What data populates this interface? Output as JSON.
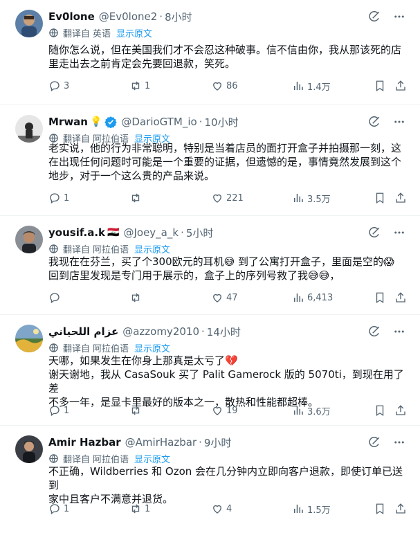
{
  "ui": {
    "translated_from_prefix": "翻译自",
    "show_original": "显示原文"
  },
  "tweets": [
    {
      "name": "Ev0lone",
      "handle": "@Ev0lone2",
      "time": "8小时",
      "language": "英语",
      "lines": [
        "随你怎么说，但在美国我们才不会忍这种破事。信不信由你，我从那该死的店",
        "里走出去之前肯定会先要回退款，笑死。"
      ],
      "replies": "3",
      "reposts": "1",
      "likes": "86",
      "views": "1.4万"
    },
    {
      "name": "Mrwan",
      "name_emoji": "💡",
      "verified": true,
      "handle": "@DarioGTM_io",
      "time": "10小时",
      "language": "阿拉伯语",
      "lines": [
        "老实说，他的行为非常聪明，特别是当着店员的面打开盒子并拍摄那一刻，这",
        "在出现任何问题时可能是一个重要的证据，但遗憾的是，事情竟然发展到这个",
        "地步，对于一个这么贵的产品来说。"
      ],
      "replies": "1",
      "reposts": "",
      "likes": "221",
      "views": "3.5万"
    },
    {
      "name": "yousif.a.k",
      "name_emoji": "🇮🇶",
      "handle": "@Joey_a_k",
      "time": "5小时",
      "language": "阿拉伯语",
      "lines": [
        "我现在在芬兰，买了个300欧元的耳机😅 到了公寓打开盒子，里面是空的😱",
        "回到店里发现是专门用于展示的，盒子上的序列号救了我😅😅，"
      ],
      "replies": "",
      "reposts": "",
      "likes": "47",
      "views": "6,413"
    },
    {
      "name": "عزام اللحياني",
      "handle": "@azzomy2010",
      "time": "14小时",
      "language": "阿拉伯语",
      "lines": [
        "天哪，如果发生在你身上那真是太亏了💔",
        "谢天谢地，我从 CasaSouk 买了 Palit Gamerock 版的 5070ti，到现在用了差",
        "不多一年，是显卡里最好的版本之一，散热和性能都超棒。"
      ],
      "replies": "1",
      "reposts": "",
      "likes": "19",
      "views": "3.6万"
    },
    {
      "name": "Amir Hazbar",
      "handle": "@AmirHazbar",
      "time": "9小时",
      "language": "阿拉伯语",
      "lines": [
        "不正确，Wildberries 和 Ozon 会在几分钟内立即向客户退款，即使订单已送到",
        "家中且客户不满意并退货。"
      ],
      "replies": "1",
      "reposts": "1",
      "likes": "4",
      "views": "1.5万"
    }
  ]
}
